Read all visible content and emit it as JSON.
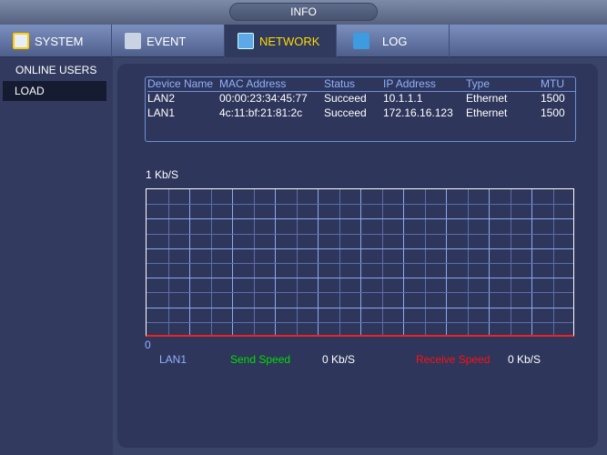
{
  "title": "INFO",
  "tabs": [
    {
      "label": "SYSTEM",
      "icon": "system-icon"
    },
    {
      "label": "EVENT",
      "icon": "event-icon"
    },
    {
      "label": "NETWORK",
      "icon": "network-icon",
      "active": true
    },
    {
      "label": "LOG",
      "icon": "log-icon"
    }
  ],
  "sidebar": {
    "items": [
      {
        "label": "ONLINE USERS"
      },
      {
        "label": "LOAD",
        "selected": true
      }
    ]
  },
  "table": {
    "headers": [
      "Device Name",
      "MAC Address",
      "Status",
      "IP Address",
      "Type",
      "MTU"
    ],
    "rows": [
      [
        "LAN2",
        "00:00:23:34:45:77",
        "Succeed",
        "10.1.1.1",
        "Ethernet",
        "1500"
      ],
      [
        "LAN1",
        "4c:11:bf:21:81:2c",
        "Succeed",
        "172.16.16.123",
        "Ethernet",
        "1500"
      ]
    ]
  },
  "chart": {
    "y_max_label": "1 Kb/S",
    "y_min_label": "0",
    "interface": "LAN1",
    "send_label": "Send Speed",
    "send_value": "0 Kb/S",
    "receive_label": "Receive Speed",
    "receive_value": "0 Kb/S"
  },
  "colors": {
    "active_tab": "#ffd800",
    "send": "#00e000",
    "receive": "#ff1010",
    "header": "#8fb2ff"
  }
}
